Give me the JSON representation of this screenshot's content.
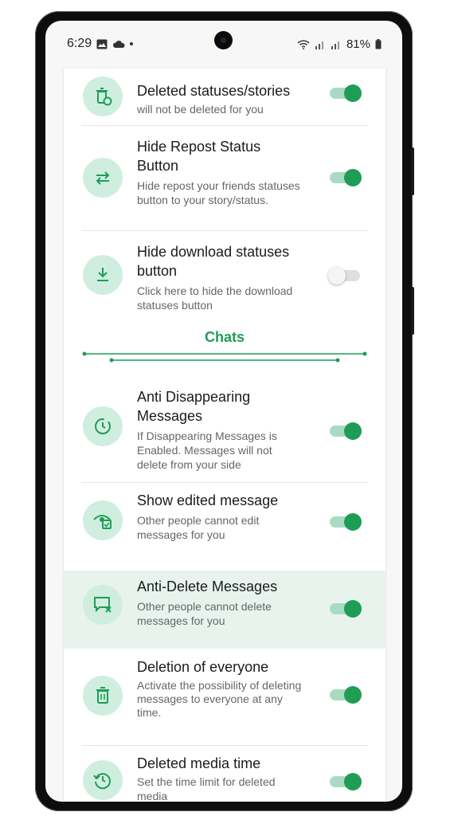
{
  "status_bar": {
    "time": "6:29",
    "battery": "81%"
  },
  "colors": {
    "accent": "#1f9d55",
    "icon_bg": "#cfeee0",
    "highlight_bg": "#e8f3ee"
  },
  "section_title": "Chats",
  "settings": [
    {
      "title": "Deleted statuses/stories",
      "desc": "will not be deleted for you",
      "enabled": true,
      "icon": "trash-refresh-icon"
    },
    {
      "title": "Hide Repost Status Button",
      "desc": "Hide repost your friends statuses button to your story/status.",
      "enabled": true,
      "icon": "repost-icon"
    },
    {
      "title": "Hide download statuses button",
      "desc": "Click here to hide the download statuses button",
      "enabled": false,
      "icon": "download-icon"
    },
    {
      "title": "Anti Disappearing Messages",
      "desc": "If Disappearing Messages is Enabled. Messages will not delete from your side",
      "enabled": true,
      "icon": "timer-icon"
    },
    {
      "title": "Show edited message",
      "desc": "Other people cannot edit messages for you",
      "enabled": true,
      "icon": "eye-edit-icon"
    },
    {
      "title": "Anti-Delete Messages",
      "desc": "Other people cannot delete messages for you",
      "enabled": true,
      "icon": "message-delete-icon"
    },
    {
      "title": "Deletion of everyone",
      "desc": "Activate the possibility of deleting messages to everyone at any time.",
      "enabled": true,
      "icon": "trash-icon"
    },
    {
      "title": "Deleted media time",
      "desc": "Set the time limit for deleted media",
      "enabled": true,
      "icon": "clock-history-icon"
    }
  ]
}
